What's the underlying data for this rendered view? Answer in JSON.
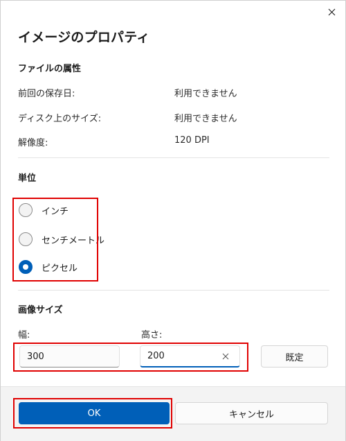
{
  "window": {
    "title": "イメージのプロパティ"
  },
  "file_attributes": {
    "heading": "ファイルの属性",
    "rows": [
      {
        "label": "前回の保存日:",
        "value": "利用できません"
      },
      {
        "label": "ディスク上のサイズ:",
        "value": "利用できません"
      },
      {
        "label": "解像度:",
        "value": "120 DPI"
      }
    ]
  },
  "units": {
    "heading": "単位",
    "options": [
      {
        "label": "インチ",
        "checked": false
      },
      {
        "label": "センチメートル",
        "checked": false
      },
      {
        "label": "ピクセル",
        "checked": true
      }
    ]
  },
  "image_size": {
    "heading": "画像サイズ",
    "width_label": "幅:",
    "width_value": "300",
    "height_label": "高さ:",
    "height_value": "200",
    "default_button": "既定"
  },
  "footer": {
    "ok_label": "OK",
    "cancel_label": "キャンセル"
  },
  "colors": {
    "accent": "#005fb8",
    "highlight": "#e00000"
  }
}
